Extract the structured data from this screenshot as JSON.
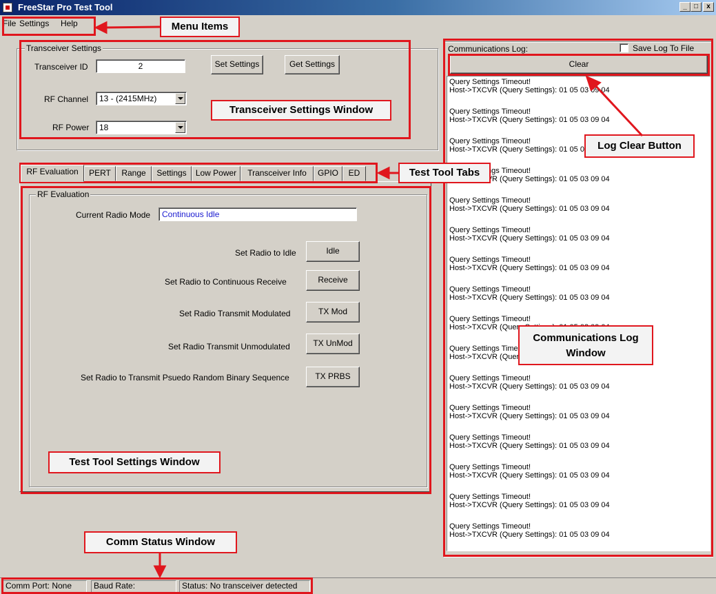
{
  "window": {
    "title": "FreeStar Pro Test Tool",
    "min": "_",
    "max": "□",
    "close": "x"
  },
  "menu": {
    "file": "File",
    "settings": "Settings",
    "help": "Help"
  },
  "transceiver_settings": {
    "group_label": "Transceiver Settings",
    "id_label": "Transceiver ID",
    "id_value": "2",
    "set_button": "Set Settings",
    "get_button": "Get Settings",
    "rf_channel_label": "RF Channel",
    "rf_channel_value": "13 - (2415MHz)",
    "rf_power_label": "RF Power",
    "rf_power_value": "18"
  },
  "tabs": [
    "RF Evaluation",
    "PERT",
    "Range",
    "Settings",
    "Low Power",
    "Transceiver Info",
    "GPIO",
    "ED"
  ],
  "rf_evaluation": {
    "group_label": "RF Evaluation",
    "current_mode_label": "Current Radio Mode",
    "current_mode_value": "Continuous Idle",
    "rows": [
      {
        "label": "Set Radio to Idle",
        "button": "Idle"
      },
      {
        "label": "Set Radio to  Continuous Receive",
        "button": "Receive"
      },
      {
        "label": "Set Radio Transmit Modulated",
        "button": "TX Mod"
      },
      {
        "label": "Set Radio Transmit Unmodulated",
        "button": "TX UnMod"
      },
      {
        "label": "Set Radio to Transmit Psuedo Random Binary Sequence",
        "button": "TX PRBS"
      }
    ]
  },
  "comm_log": {
    "label": "Communications Log:",
    "save_label": "Save Log To File",
    "save_checked": false,
    "clear_button": "Clear",
    "entries": [
      {
        "l1": "Query Settings Timeout!",
        "l2": "Host->TXCVR (Query Settings): 01 05 03 09 04"
      },
      {
        "l1": "Query Settings Timeout!",
        "l2": "Host->TXCVR (Query Settings): 01 05 03 09 04"
      },
      {
        "l1": "Query Settings Timeout!",
        "l2": "Host->TXCVR (Query Settings): 01 05 03 09 04"
      },
      {
        "l1": "Query Settings Timeout!",
        "l2": "Host->TXCVR (Query Settings): 01 05 03 09 04"
      },
      {
        "l1": "Query Settings Timeout!",
        "l2": "Host->TXCVR (Query Settings): 01 05 03 09 04"
      },
      {
        "l1": "Query Settings Timeout!",
        "l2": "Host->TXCVR (Query Settings): 01 05 03 09 04"
      },
      {
        "l1": "Query Settings Timeout!",
        "l2": "Host->TXCVR (Query Settings): 01 05 03 09 04"
      },
      {
        "l1": "Query Settings Timeout!",
        "l2": "Host->TXCVR (Query Settings): 01 05 03 09 04"
      },
      {
        "l1": "Query Settings Timeout!",
        "l2": "Host->TXCVR (Query Settings): 01 05 03 09 04"
      },
      {
        "l1": "Query Settings Timeout!",
        "l2": "Host->TXCVR (Query Settings): 01 05 03 09 04"
      },
      {
        "l1": "Query Settings Timeout!",
        "l2": "Host->TXCVR (Query Settings): 01 05 03 09 04"
      },
      {
        "l1": "Query Settings Timeout!",
        "l2": "Host->TXCVR (Query Settings): 01 05 03 09 04"
      },
      {
        "l1": "Query Settings Timeout!",
        "l2": "Host->TXCVR (Query Settings): 01 05 03 09 04"
      },
      {
        "l1": "Query Settings Timeout!",
        "l2": "Host->TXCVR (Query Settings): 01 05 03 09 04"
      },
      {
        "l1": "Query Settings Timeout!",
        "l2": "Host->TXCVR (Query Settings): 01 05 03 09 04"
      },
      {
        "l1": "Query Settings Timeout!",
        "l2": "Host->TXCVR (Query Settings): 01 05 03 09 04"
      }
    ]
  },
  "status_bar": {
    "comm_port": "Comm Port: None",
    "baud_rate": "Baud Rate:",
    "status": "Status: No transceiver detected"
  },
  "annotations": {
    "menu_items": "Menu Items",
    "transceiver_settings_window": "Transceiver Settings Window",
    "test_tool_tabs": "Test Tool Tabs",
    "log_clear_button": "Log Clear Button",
    "communications_log_window_1": "Communications Log",
    "communications_log_window_2": "Window",
    "test_tool_settings_window": "Test Tool Settings Window",
    "comm_status_window": "Comm Status Window"
  },
  "colors": {
    "annotation_red": "#e0161d",
    "mode_text_blue": "#1a1ad0",
    "title_blue": "#0a246a"
  }
}
